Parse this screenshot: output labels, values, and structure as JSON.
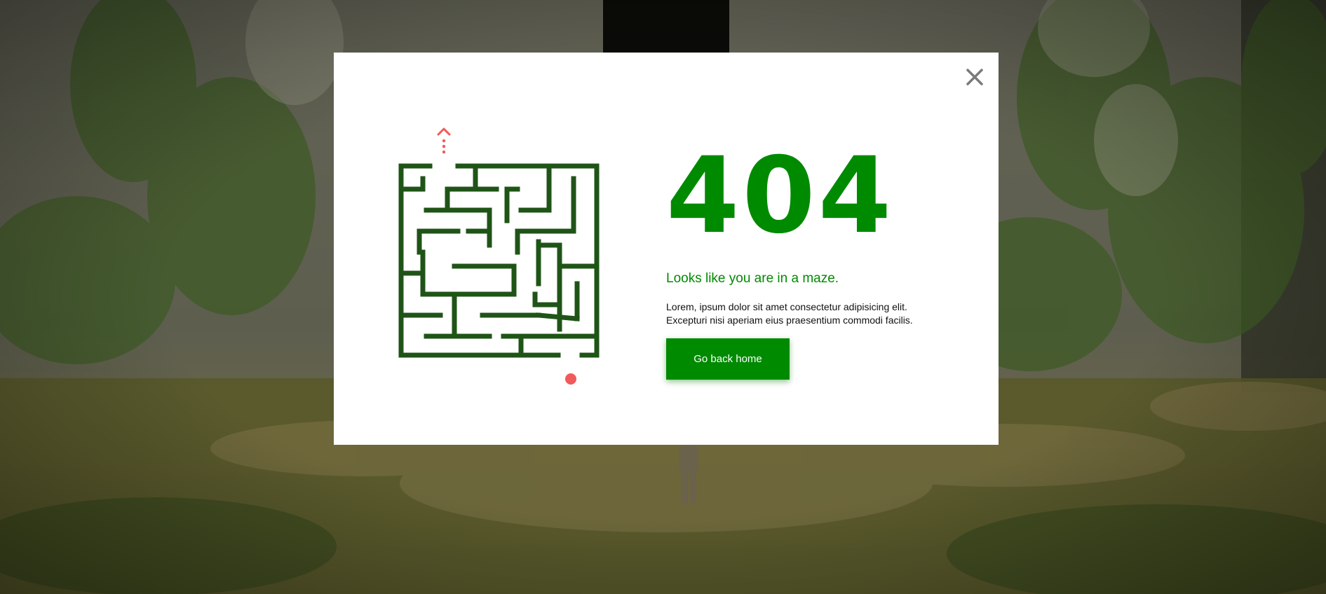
{
  "page": {
    "error_code": "404",
    "subtitle": "Looks like you are in a maze.",
    "description_lines": [
      "Lorem, ipsum dolor sit amet consectetur adipisicing elit.",
      "Excepturi nisi aperiam eius praesentium commodi facilis."
    ],
    "button_label": "Go back home"
  },
  "icons": {
    "close": "close-icon",
    "maze": "maze-illustration",
    "exit_arrow": "up-arrow-icon",
    "start_dot": "dot-marker"
  },
  "colors": {
    "accent_green": "#008a00",
    "maze_green": "#1f5417",
    "marker_red": "#f05a5a",
    "close_gray": "#7a7a7a",
    "modal_bg": "#ffffff"
  }
}
